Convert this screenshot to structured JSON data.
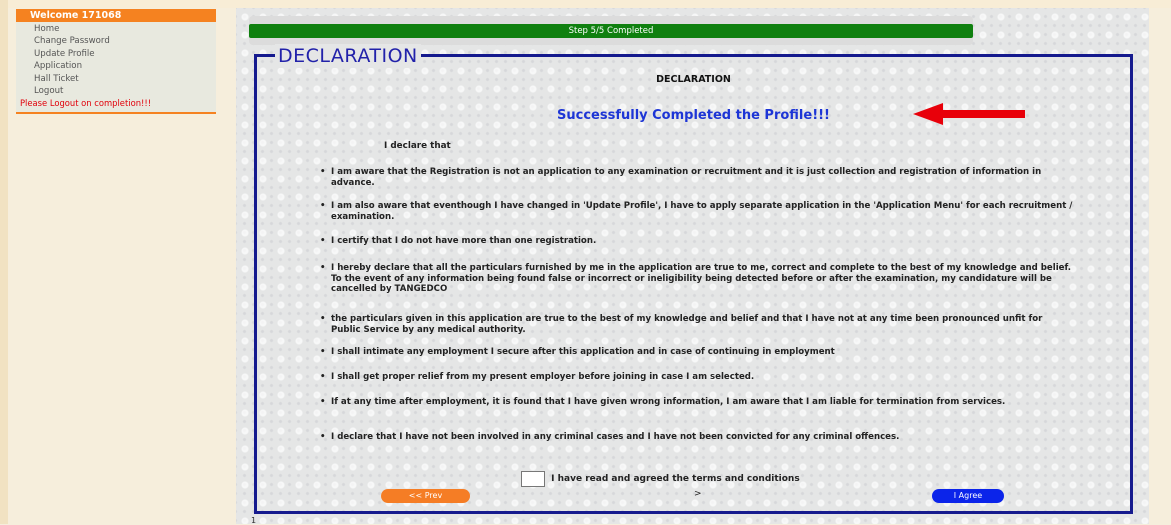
{
  "sidebar": {
    "welcome": "Welcome 171068",
    "items": [
      {
        "label": "Home"
      },
      {
        "label": "Change Password"
      },
      {
        "label": "Update Profile"
      },
      {
        "label": "Application"
      },
      {
        "label": "Hall Ticket"
      },
      {
        "label": "Logout"
      }
    ],
    "logout_note": "Please Logout on completion!!!"
  },
  "progress": {
    "label": "Step 5/5 Completed",
    "fraction": 1.0
  },
  "declaration": {
    "legend": "DECLARATION",
    "title": "DECLARATION",
    "success_message": "Successfully Completed the Profile!!!",
    "intro": "I declare that",
    "items": [
      "I am aware that the Registration is not an application to any examination or recruitment and it is just collection and registration of information in advance.",
      "I am also aware that eventhough I have changed in 'Update Profile', I have to apply separate application in the 'Application Menu' for each recruitment / examination.",
      "I certify that I do not have more than one registration.",
      "I hereby declare that all the particulars furnished by me in the application are true to me, correct and complete to the best of my knowledge and belief. To the event of any information being found false or incorrect or ineligibility being detected before or after the examination, my candidature will be cancelled by TANGEDCO",
      "the particulars given in this application are true to the best of my knowledge and belief and that I have not at any time been pronounced unfit for Public Service by any medical authority.",
      "I shall intimate any employment I secure after this application and in case of continuing in employment",
      "I shall get proper relief from my present employer before joining in case I am selected.",
      "If at any time after employment, it is found that I have given wrong information, I am aware that I am liable for termination from services.",
      "I declare that I have not been involved in any criminal cases and I have not been convicted for any criminal offences."
    ],
    "terms_label": "I have read and agreed the terms and conditions",
    "checkbox_checked": false
  },
  "buttons": {
    "prev": "<< Prev",
    "separator": ">",
    "agree": "I Agree"
  },
  "footer_mark": "1",
  "colors": {
    "accent_orange": "#f58220",
    "progress_green": "#0f800f",
    "border_navy": "#151a8e",
    "success_blue": "#1d35d6",
    "agree_blue": "#0b24ea",
    "annotation_red": "#e8000a"
  }
}
